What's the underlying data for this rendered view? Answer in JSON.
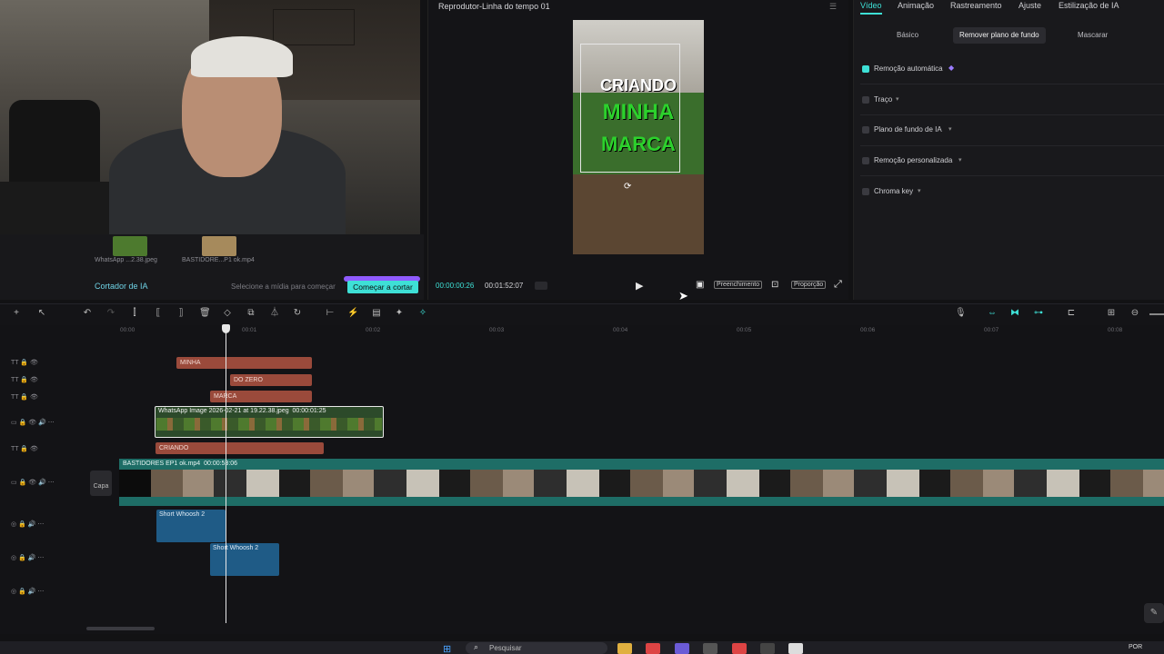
{
  "media": {
    "items": [
      {
        "name": "WhatsApp ...2.38.jpeg"
      },
      {
        "name": "BASTIDORE...P1 ok.mp4"
      }
    ],
    "cortador_label": "Cortador de IA",
    "hint": "Selecione a mídia para começar",
    "start_button": "Começar a cortar"
  },
  "player": {
    "title": "Reprodutor-Linha do tempo 01",
    "time_current": "00:00:00:26",
    "time_total": "00:01:52:07",
    "fill_label": "Preenchimento",
    "ratio_label": "Proporção",
    "preview_lines": [
      "CRIANDO",
      "MINHA",
      "MARCA"
    ]
  },
  "right_panel": {
    "tabs": [
      "Vídeo",
      "Animação",
      "Rastreamento",
      "Ajuste",
      "Estilização de IA"
    ],
    "subtabs": [
      "Básico",
      "Remover plano de fundo",
      "Mascarar"
    ],
    "options": [
      {
        "label": "Remoção automática",
        "checked": true
      },
      {
        "label": "Traço",
        "checked": false
      },
      {
        "label": "Plano de fundo de IA",
        "checked": false
      },
      {
        "label": "Remoção personalizada",
        "checked": false
      },
      {
        "label": "Chroma key",
        "checked": false
      }
    ]
  },
  "timeline": {
    "ruler": [
      "00:00",
      "00:01",
      "00:02",
      "00:03",
      "00:04",
      "00:05",
      "00:06",
      "00:07",
      "00:08"
    ],
    "text_clips": [
      "MINHA",
      "DO ZERO",
      "MARCA",
      "CRIANDO"
    ],
    "image_clip": {
      "label": "WhatsApp Image 2026-02-21 at 19.22.38.jpeg",
      "duration": "00:00:01:25"
    },
    "main_clip": {
      "label": "BASTIDORES EP1 ok.mp4",
      "duration": "00:00:53:06"
    },
    "audio_clips": [
      "Short Whoosh 2",
      "Short Whoosh 2"
    ],
    "capa_label": "Capa"
  },
  "taskbar": {
    "search_placeholder": "Pesquisar",
    "lang": "POR"
  },
  "colors": {
    "accent": "#3ee0d6",
    "text_clip": "#9a4a3b",
    "main_clip": "#1e6d66",
    "audio_clip": "#1f5b86"
  }
}
